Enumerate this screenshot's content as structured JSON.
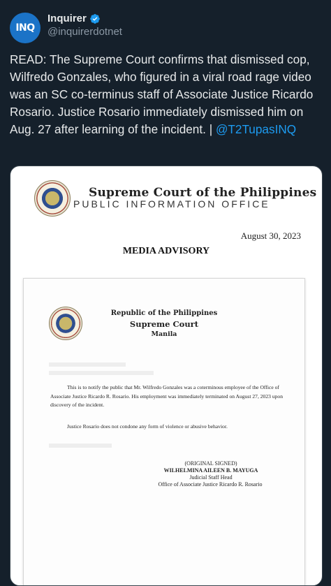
{
  "author": {
    "avatar_text": "INQ",
    "display_name": "Inquirer",
    "handle": "@inquirerdotnet",
    "verified": true
  },
  "tweet": {
    "text": "READ: The Supreme Court confirms that dismissed cop, Wilfredo Gonzales, who figured in a viral road rage video was an SC co-terminus staff of Associate Justice Ricardo Rosario. Justice Rosario immediately dismissed him on Aug. 27 after learning of the incident. | ",
    "mention": "@T2TupasINQ"
  },
  "document": {
    "title": "Supreme Court of the Philippines",
    "subtitle": "PUBLIC INFORMATION OFFICE",
    "date": "August 30, 2023",
    "heading": "MEDIA ADVISORY",
    "letter": {
      "header_line1": "Republic of the Philippines",
      "header_line2": "Supreme Court",
      "header_line3": "Manila",
      "paragraph1": "This is to notify the public that Mr. Wilfredo Gonzales was a coterminous employee of the Office of Associate Justice Ricardo R. Rosario. His employment was immediately terminated on August 27, 2023 upon discovery of the incident.",
      "paragraph2": "Justice Rosario does not condone any form of violence or abusive behavior.",
      "signed": "(ORIGINAL SIGNED)",
      "signatory": "WILHELMINA AILEEN B. MAYUGA",
      "position": "Judicial Staff Head",
      "office": "Office of Associate Justice Ricardo R. Rosario"
    }
  },
  "colors": {
    "background": "#15202b",
    "text": "#e7e9ea",
    "muted": "#8b98a5",
    "link": "#1d9bf0",
    "avatar": "#1b73c7"
  },
  "icons": {
    "verified": "verified-badge-icon"
  }
}
